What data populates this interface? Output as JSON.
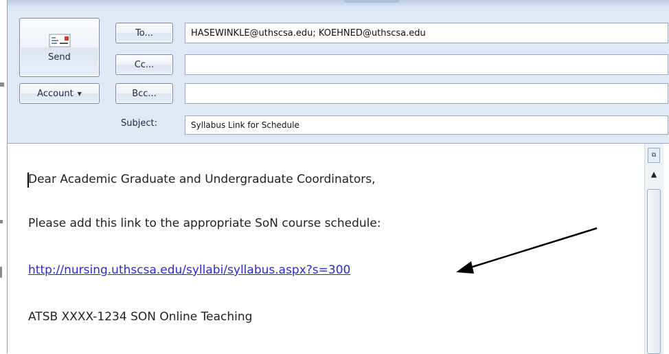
{
  "toolbar": {
    "send_label": "Send",
    "account_label": "Account",
    "to_label": "To...",
    "cc_label": "Cc...",
    "bcc_label": "Bcc...",
    "subject_label": "Subject:"
  },
  "fields": {
    "to_value": "HASEWINKLE@uthscsa.edu; KOEHNED@uthscsa.edu",
    "cc_value": "",
    "bcc_value": "",
    "subject_value": "Syllabus Link for Schedule"
  },
  "body": {
    "greeting": "Dear Academic Graduate and Undergraduate Coordinators,",
    "instruction": "Please add this link to the appropriate SoN course schedule:",
    "link": "http://nursing.uthscsa.edu/syllabi/syllabus.aspx?s=300",
    "course": "ATSB XXXX-1234 SON Online Teaching"
  },
  "icons": {
    "send": "envelope-icon",
    "account_caret": "chevron-down-icon",
    "scroll_top": "split-view-icon",
    "scroll_up": "arrow-up-icon",
    "annotation": "pointer-arrow"
  },
  "colors": {
    "frame": "#dfe8f5",
    "link": "#2b2bc4"
  }
}
